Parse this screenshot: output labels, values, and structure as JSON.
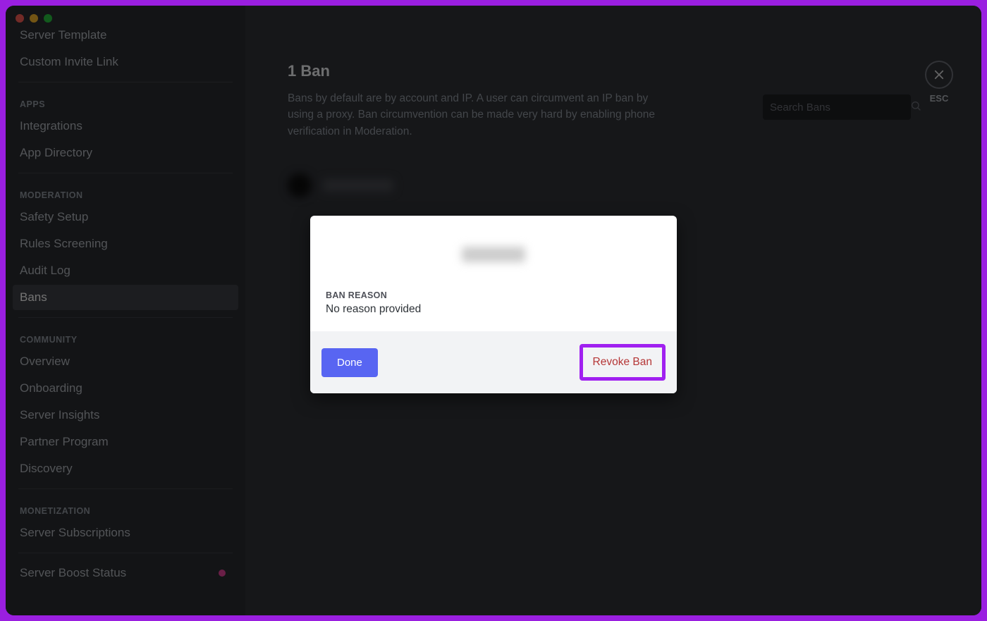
{
  "sidebar": {
    "topItems": [
      {
        "label": "Server Template"
      },
      {
        "label": "Custom Invite Link"
      }
    ],
    "sections": [
      {
        "heading": "APPS",
        "items": [
          {
            "label": "Integrations"
          },
          {
            "label": "App Directory"
          }
        ]
      },
      {
        "heading": "MODERATION",
        "items": [
          {
            "label": "Safety Setup"
          },
          {
            "label": "Rules Screening"
          },
          {
            "label": "Audit Log"
          },
          {
            "label": "Bans",
            "active": true
          }
        ]
      },
      {
        "heading": "COMMUNITY",
        "items": [
          {
            "label": "Overview"
          },
          {
            "label": "Onboarding"
          },
          {
            "label": "Server Insights"
          },
          {
            "label": "Partner Program"
          },
          {
            "label": "Discovery"
          }
        ]
      },
      {
        "heading": "MONETIZATION",
        "items": [
          {
            "label": "Server Subscriptions"
          }
        ]
      }
    ],
    "boostLabel": "Server Boost Status"
  },
  "close": {
    "esc": "ESC"
  },
  "page": {
    "title": "1 Ban",
    "descPrefix": "Bans by default are by account and IP. A user can circumvent an IP ban by using a proxy. Ban circumvention can be made very hard by enabling phone verification in ",
    "moderationLink": "Moderation",
    "descSuffix": "."
  },
  "search": {
    "placeholder": "Search Bans"
  },
  "modal": {
    "reasonLabel": "BAN REASON",
    "reasonText": "No reason provided",
    "doneLabel": "Done",
    "revokeLabel": "Revoke Ban"
  }
}
